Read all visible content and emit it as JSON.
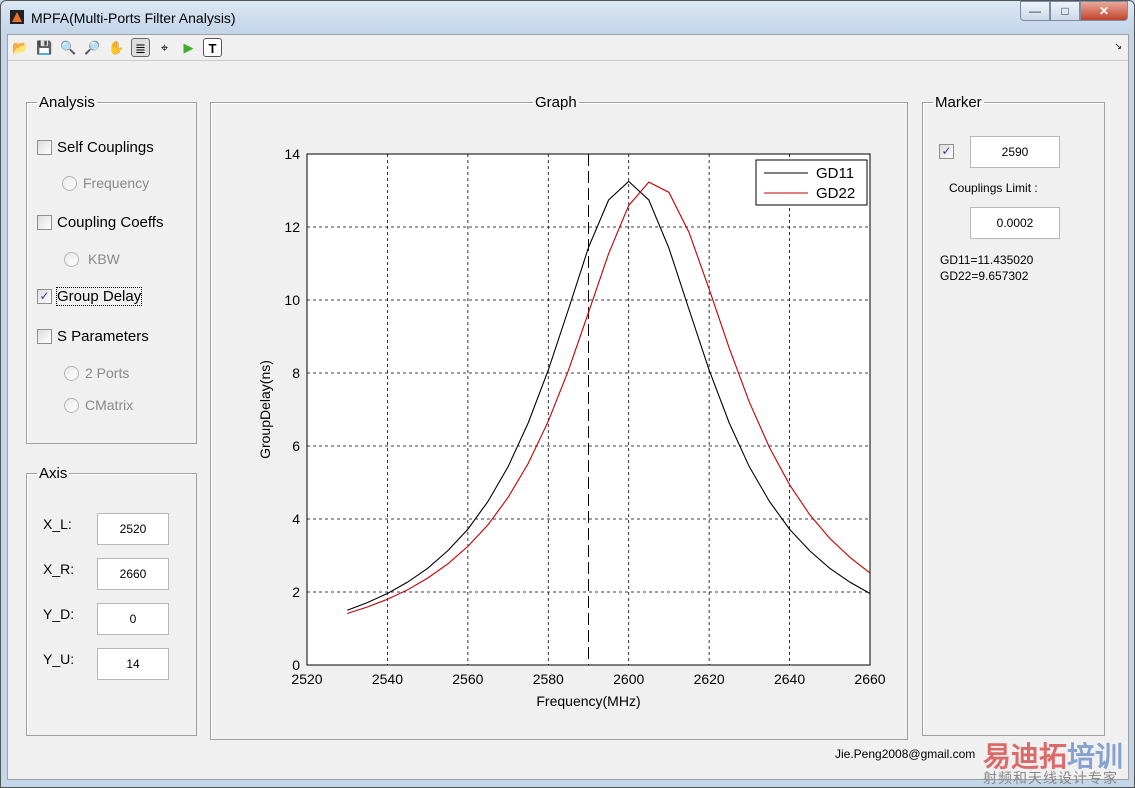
{
  "window": {
    "title": "MPFA(Multi-Ports Filter Analysis)",
    "minimize": "—",
    "maximize": "□",
    "close": "✕"
  },
  "toolbar": [
    "open-icon",
    "save-icon",
    "zoom-in-icon",
    "zoom-out-icon",
    "pan-icon",
    "legend-icon",
    "data-cursor-icon",
    "run-icon",
    "text-icon"
  ],
  "toolbar_text_label": "T",
  "analysis": {
    "title": "Analysis",
    "self_couplings": "Self Couplings",
    "frequency": "Frequency",
    "coupling_coeffs": "Coupling Coeffs",
    "kbw": "KBW",
    "group_delay": "Group Delay",
    "s_parameters": "S Parameters",
    "two_ports": "2 Ports",
    "cmatrix": "CMatrix",
    "checked": {
      "self_couplings": false,
      "coupling_coeffs": false,
      "group_delay": true,
      "s_parameters": false
    }
  },
  "axis": {
    "title": "Axis",
    "xl_label": "X_L:",
    "xl": "2520",
    "xr_label": "X_R:",
    "xr": "2660",
    "yd_label": "Y_D:",
    "yd": "0",
    "yu_label": "Y_U:",
    "yu": "14"
  },
  "graph": {
    "title": "Graph"
  },
  "marker": {
    "title": "Marker",
    "enabled": true,
    "value": "2590",
    "couplings_limit_label": "Couplings Limit :",
    "couplings_limit": "0.0002",
    "gd11": "GD11=11.435020",
    "gd22": "GD22=9.657302"
  },
  "footer": {
    "email": "Jie.Peng2008@gmail.com",
    "watermark": "易迪拓培训 射频和天线设计专家"
  },
  "chart_data": {
    "type": "line",
    "xlabel": "Frequency(MHz)",
    "ylabel": "GroupDelay(ns)",
    "xlim": [
      2520,
      2660
    ],
    "ylim": [
      0,
      14
    ],
    "grid": true,
    "legend_position": "top-right",
    "xticks": [
      "2520",
      "2540",
      "2560",
      "2580",
      "2600",
      "2620",
      "2640",
      "2660"
    ],
    "yticks": [
      "0",
      "2",
      "4",
      "6",
      "8",
      "10",
      "12",
      "14"
    ],
    "marker_x": 2590,
    "x": [
      2530,
      2535,
      2540,
      2545,
      2550,
      2555,
      2560,
      2565,
      2570,
      2575,
      2580,
      2585,
      2590,
      2595,
      2600,
      2605,
      2610,
      2615,
      2620,
      2625,
      2630,
      2635,
      2640,
      2645,
      2650,
      2655,
      2660
    ],
    "series": [
      {
        "name": "GD11",
        "color": "#000000",
        "values": [
          1.5,
          1.71,
          1.96,
          2.27,
          2.65,
          3.13,
          3.72,
          4.48,
          5.43,
          6.63,
          8.08,
          9.74,
          11.44,
          12.74,
          13.25,
          12.74,
          11.42,
          9.74,
          8.08,
          6.63,
          5.43,
          4.48,
          3.72,
          3.13,
          2.65,
          2.27,
          1.96
        ]
      },
      {
        "name": "GD22",
        "color": "#c00000",
        "values": [
          1.41,
          1.59,
          1.8,
          2.06,
          2.38,
          2.77,
          3.25,
          3.84,
          4.59,
          5.52,
          6.68,
          8.07,
          9.66,
          11.27,
          12.59,
          13.23,
          12.95,
          11.85,
          10.3,
          8.68,
          7.2,
          5.96,
          4.94,
          4.12,
          3.47,
          2.95,
          2.52
        ]
      }
    ]
  }
}
